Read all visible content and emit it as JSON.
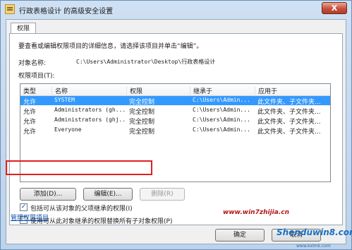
{
  "window": {
    "title": "行政表格设计 的高级安全设置",
    "close_glyph": "X"
  },
  "tab": {
    "label": "权限"
  },
  "intro_text": "要查看或编辑权限项目的详细信息，请选择该项目并单击“编辑”。",
  "object": {
    "label": "对象名称:",
    "value": "C:\\Users\\Administrator\\Desktop\\行政表格设计"
  },
  "entries_label": "权限项目(T):",
  "columns": [
    "类型",
    "名称",
    "权限",
    "继承于",
    "应用于"
  ],
  "rows": [
    {
      "type": "允许",
      "name": "SYSTEM",
      "permission": "完全控制",
      "inherited": "C:\\Users\\Admin...",
      "applies": "此文件夹、子文件夹..."
    },
    {
      "type": "允许",
      "name": "Administrators (gh...",
      "permission": "完全控制",
      "inherited": "C:\\Users\\Admin...",
      "applies": "此文件夹、子文件夹..."
    },
    {
      "type": "允许",
      "name": "Administrators (ghj...",
      "permission": "完全控制",
      "inherited": "C:\\Users\\Admin...",
      "applies": "此文件夹、子文件夹..."
    },
    {
      "type": "允许",
      "name": "Everyone",
      "permission": "完全控制",
      "inherited": "C:\\Users\\Admin...",
      "applies": "此文件夹、子文件夹..."
    }
  ],
  "buttons": {
    "add": "添加(D)...",
    "edit": "编辑(E)...",
    "remove": "删除(R)",
    "ok": "确定",
    "cancel": "取消"
  },
  "checkboxes": {
    "inherit": {
      "label": "包括可从该对象的父项继承的权限(I)",
      "checked": true,
      "mark": "✓"
    },
    "replace": {
      "label": "使用可从此对象继承的权限替换所有子对象权限(P)",
      "checked": false,
      "mark": ""
    }
  },
  "manage_link": "管理权限项目",
  "watermark": {
    "url": "www.win7zhijia.cn",
    "brand": "Shenduwin8.com",
    "sub": "www.kxlmk.com"
  }
}
